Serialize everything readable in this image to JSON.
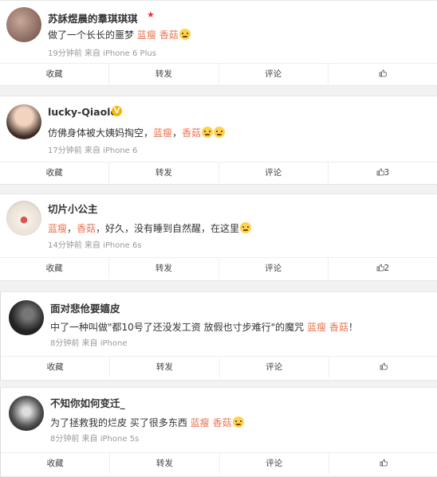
{
  "posts": [
    {
      "username": "苏訸煜晨的羣琪琪琪",
      "text_prefix": "做了一个长长的噩梦",
      "tag1": "蓝瘦",
      "tag2": "香菇",
      "text_suffix": "",
      "meta": "19分钟前 来自 iPhone 6 Plus",
      "actions": {
        "favorite": "收藏",
        "repost": "转发",
        "comment": "评论",
        "like_count": ""
      }
    },
    {
      "username": "lucky-Qiaole",
      "text_prefix": "仿佛身体被大姨妈掏空，",
      "tag1": "蓝瘦",
      "tag2": "香菇",
      "text_suffix": "",
      "meta": "17分钟前 来自 iPhone 6",
      "actions": {
        "favorite": "收藏",
        "repost": "转发",
        "comment": "评论",
        "like_count": "3"
      }
    },
    {
      "username": "切片小公主",
      "text_prefix": "",
      "tag1": "蓝瘦",
      "tag2": "香菇",
      "text_suffix": "，好久，没有睡到自然醒，在这里",
      "meta": "14分钟前 来自 iPhone 6s",
      "actions": {
        "favorite": "收藏",
        "repost": "转发",
        "comment": "评论",
        "like_count": "2"
      }
    },
    {
      "username": "面对悲伧要嬉皮",
      "text_prefix": "中了一种叫做\"都10号了还没发工资 放假也寸步难行\"的魔咒",
      "tag1": "蓝瘦",
      "tag2": "香菇",
      "text_suffix": "！",
      "meta": "8分钟前 来自 iPhone",
      "actions": {
        "favorite": "收藏",
        "repost": "转发",
        "comment": "评论",
        "like_count": ""
      }
    },
    {
      "username": "不知你如何变迁_",
      "text_prefix": "为了拯救我的烂皮 买了很多东西",
      "tag1": "蓝瘦",
      "tag2": "香菇",
      "text_suffix": "",
      "meta": "8分钟前 来自 iPhone 5s",
      "actions": {
        "favorite": "收藏",
        "repost": "转发",
        "comment": "评论",
        "like_count": ""
      }
    }
  ],
  "colors": {
    "tag": "#eb7350",
    "meta": "#999999",
    "background": "#f2f2f2"
  },
  "icons": {
    "like": "thumbs-up-icon",
    "star": "star-icon",
    "verified": "verified-v-icon"
  }
}
